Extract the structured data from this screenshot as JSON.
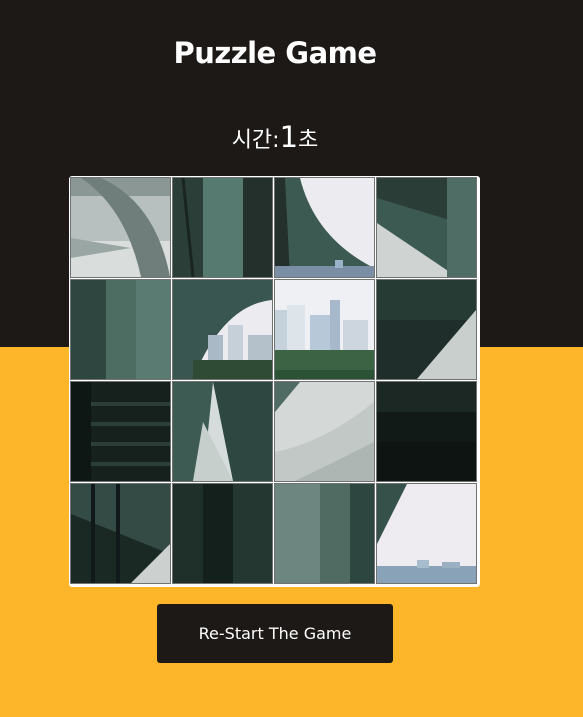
{
  "header": {
    "title": "Puzzle Game"
  },
  "timer": {
    "label": "시간:",
    "value": "1",
    "unit": "초"
  },
  "puzzle": {
    "grid": "4x4",
    "tile_order": [
      4,
      6,
      7,
      8,
      1,
      13,
      14,
      9,
      2,
      11,
      3,
      12,
      5,
      10,
      15,
      16
    ]
  },
  "controls": {
    "restart_label": "Re-Start The Game"
  },
  "colors": {
    "top_background": "#1d1917",
    "bottom_background": "#fdb52a",
    "button_background": "#1d1917",
    "text": "#ffffff"
  }
}
